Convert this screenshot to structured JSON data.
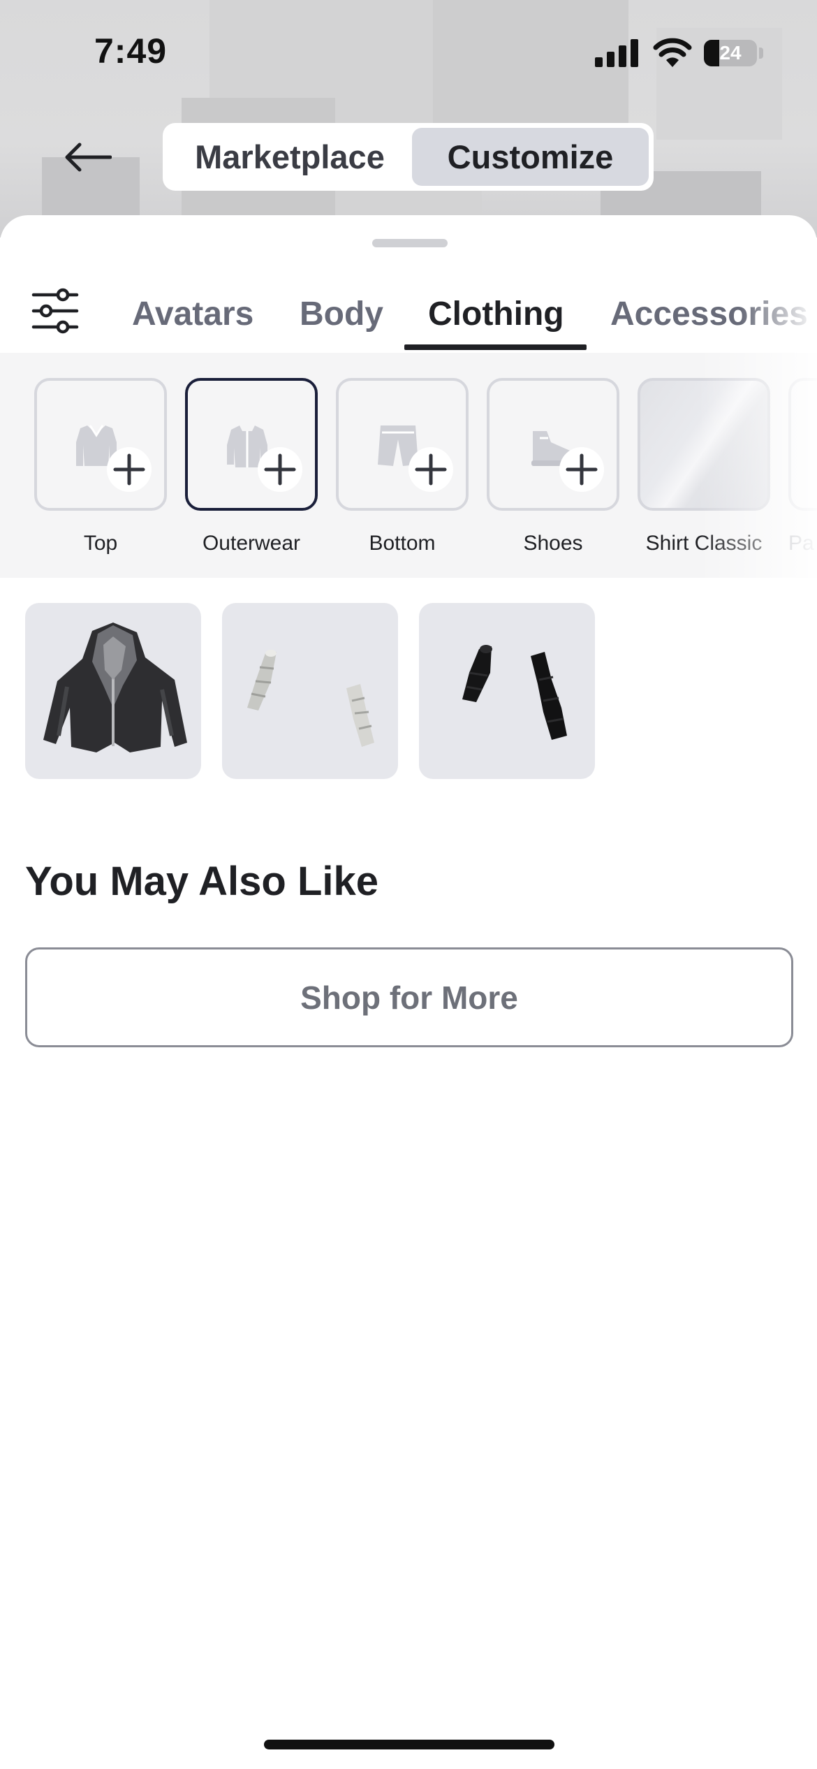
{
  "status_bar": {
    "time": "7:49",
    "battery": "24",
    "icons": [
      "signal-icon",
      "wifi-icon",
      "battery-icon"
    ]
  },
  "header": {
    "back_icon": "arrow-left-icon",
    "segments": [
      {
        "label": "Marketplace",
        "selected": false
      },
      {
        "label": "Customize",
        "selected": true
      }
    ]
  },
  "tabs": {
    "filter_icon": "sliders-icon",
    "items": [
      {
        "label": "Avatars",
        "active": false
      },
      {
        "label": "Body",
        "active": false
      },
      {
        "label": "Clothing",
        "active": true
      },
      {
        "label": "Accessories",
        "active": false
      }
    ]
  },
  "categories": [
    {
      "label": "Top",
      "icon": "shirt-icon",
      "selected": false
    },
    {
      "label": "Outerwear",
      "icon": "jacket-icon",
      "selected": true
    },
    {
      "label": "Bottom",
      "icon": "shorts-icon",
      "selected": false
    },
    {
      "label": "Shoes",
      "icon": "sneaker-icon",
      "selected": false
    },
    {
      "label": "Shirt Classic",
      "icon": "classic-shirt-thumbnail",
      "selected": false
    },
    {
      "label": "Pa",
      "icon": "pants-classic-thumbnail",
      "selected": false
    }
  ],
  "equipped_items": [
    {
      "icon": "black-hooded-jacket-thumbnail"
    },
    {
      "icon": "white-leg-warmers-thumbnail"
    },
    {
      "icon": "black-leg-warmers-thumbnail"
    }
  ],
  "recommendations": {
    "title": "You May Also Like",
    "shop_button": "Shop for More"
  },
  "colors": {
    "accent_selected_border": "#1a1f3a",
    "segment_selected_bg": "#d7d9e0",
    "tile_bg": "#e6e7ec"
  }
}
